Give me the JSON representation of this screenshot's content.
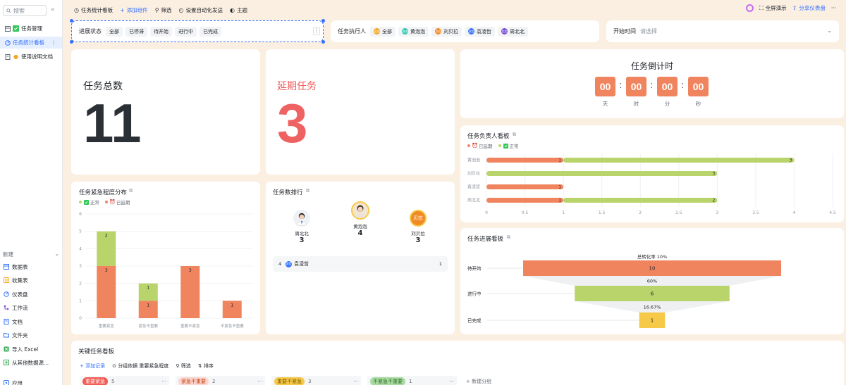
{
  "sidebar": {
    "search_placeholder": "搜索",
    "collapse_icon": "«",
    "items": [
      {
        "label": "任务管理"
      },
      {
        "label": "任务统计看板"
      },
      {
        "label": "使用说明文档"
      }
    ],
    "new_label": "新建",
    "new_items": [
      {
        "label": "数据表"
      },
      {
        "label": "收集表"
      },
      {
        "label": "仪表盘"
      },
      {
        "label": "工作流"
      },
      {
        "label": "文档"
      },
      {
        "label": "文件夹"
      },
      {
        "label": "导入 Excel"
      },
      {
        "label": "从其他数据源..."
      },
      {
        "label": "应用"
      }
    ]
  },
  "toolbar": {
    "title": "任务统计看板",
    "add_widget": "添加组件",
    "filter": "筛选",
    "automation": "设置自动化发送",
    "theme": "主题",
    "fullscreen": "全屏演示",
    "share": "分享仪表盘",
    "more": "···"
  },
  "filters": {
    "status_label": "进展状态",
    "status_options": [
      "全部",
      "已停滞",
      "待开始",
      "进行中",
      "已完成"
    ],
    "assignee_label": "任务执行人",
    "assignees": [
      {
        "name": "全部",
        "abbr": "全部",
        "color": "#f5a623"
      },
      {
        "name": "黄泡泡",
        "abbr": "泡泡",
        "color": "#2ac8b0"
      },
      {
        "name": "刘贝拉",
        "abbr": "贝拉",
        "color": "#f08a24"
      },
      {
        "name": "袁凌哲",
        "abbr": "凌哲",
        "color": "#3370ff"
      },
      {
        "name": "周北北",
        "abbr": "北北",
        "color": "#7b4fd6"
      }
    ],
    "start_label": "开始时间",
    "start_placeholder": "请选择"
  },
  "stats": {
    "total_label": "任务总数",
    "total_value": "11",
    "delayed_label": "延期任务",
    "delayed_value": "3"
  },
  "countdown": {
    "title": "任务倒计时",
    "units": [
      {
        "value": "00",
        "label": "天"
      },
      {
        "value": "00",
        "label": "时"
      },
      {
        "value": "00",
        "label": "分"
      },
      {
        "value": "00",
        "label": "秒"
      }
    ],
    "sep": ":"
  },
  "assignee_chart": {
    "title": "任务负责人看板",
    "legend": [
      "已延期",
      "正常"
    ],
    "colors": {
      "delayed": "#f0845f",
      "normal": "#b9d46a"
    },
    "chart_data": {
      "type": "bar",
      "orientation": "horizontal",
      "stacked": true,
      "categories": [
        "黄泡泡",
        "刘贝拉",
        "袁凌哲",
        "周北北"
      ],
      "series": [
        {
          "name": "已延期",
          "values": [
            1,
            0,
            1,
            1
          ]
        },
        {
          "name": "正常",
          "values": [
            3,
            3,
            0,
            2
          ]
        }
      ],
      "xlim": [
        0,
        4.5
      ],
      "xticks": [
        "0",
        "0.5",
        "1",
        "1.5",
        "2",
        "2.5",
        "3",
        "3.5",
        "4",
        "4.5"
      ]
    }
  },
  "urgency_chart": {
    "title": "任务紧急程度分布",
    "legend": [
      "正常",
      "已延期"
    ],
    "chart_data": {
      "type": "bar",
      "stacked": true,
      "categories": [
        "重要紧急",
        "紧急不重要",
        "重要不紧急",
        "不紧急不重要"
      ],
      "series": [
        {
          "name": "正常",
          "values": [
            2,
            1,
            0,
            0
          ]
        },
        {
          "name": "已延期",
          "values": [
            3,
            1,
            3,
            1
          ]
        }
      ],
      "ylim": [
        0,
        6
      ],
      "yticks": [
        "0",
        "1",
        "2",
        "3",
        "4",
        "5",
        "6"
      ]
    }
  },
  "ranking": {
    "title": "任务数排行",
    "top": [
      {
        "rank": 1,
        "name": "黄泡泡",
        "count": "4"
      },
      {
        "rank": 2,
        "name": "周北北",
        "count": "3"
      },
      {
        "rank": 3,
        "name": "刘贝拉",
        "count": "3",
        "abbr": "贝拉"
      }
    ],
    "row": {
      "rank": "4",
      "abbr": "凌哲",
      "name": "袁凌哲",
      "count": "1"
    }
  },
  "funnel": {
    "title": "任务进展看板",
    "total_rate": "总转化率 10%",
    "chart_data": {
      "type": "funnel",
      "stages": [
        {
          "label": "待开始",
          "value": 10
        },
        {
          "label": "进行中",
          "value": 6
        },
        {
          "label": "已完成",
          "value": 1
        }
      ],
      "conversion": [
        "60%",
        "16.67%"
      ]
    }
  },
  "kanban": {
    "title": "关键任务看板",
    "add_record": "添加记录",
    "group_by": "分组依据 重要紧急程度",
    "filter": "筛选",
    "sort": "排序",
    "groups": [
      {
        "label": "重要紧急",
        "count": "5",
        "color": "#f25c54",
        "text": "#fff"
      },
      {
        "label": "紧急不重要",
        "count": "2",
        "color": "#fcd6cf",
        "text": "#c2410c"
      },
      {
        "label": "重要不紧急",
        "count": "3",
        "color": "#f7c948",
        "text": "#7a5a00"
      },
      {
        "label": "不紧急不重要",
        "count": "1",
        "color": "#a9dba0",
        "text": "#2f6b28"
      }
    ],
    "new_group": "新建分组"
  }
}
